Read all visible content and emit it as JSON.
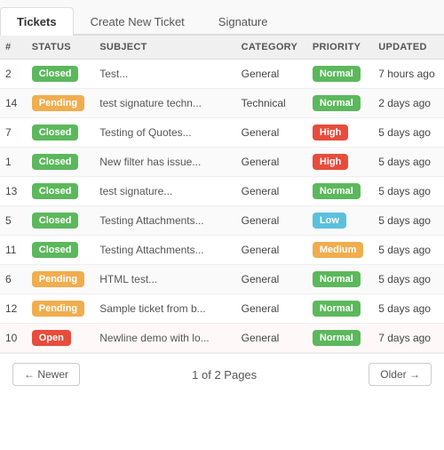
{
  "tabs": [
    {
      "id": "tickets",
      "label": "Tickets",
      "active": true
    },
    {
      "id": "create",
      "label": "Create New Ticket",
      "active": false
    },
    {
      "id": "signature",
      "label": "Signature",
      "active": false
    }
  ],
  "table": {
    "columns": [
      {
        "id": "num",
        "label": "#"
      },
      {
        "id": "status",
        "label": "STATUS"
      },
      {
        "id": "subject",
        "label": "SUBJECT"
      },
      {
        "id": "category",
        "label": "CATEGORY"
      },
      {
        "id": "priority",
        "label": "PRIORITY"
      },
      {
        "id": "updated",
        "label": "UPDATED"
      }
    ],
    "rows": [
      {
        "num": "2",
        "status": "Closed",
        "status_type": "closed",
        "subject": "Test...",
        "category": "General",
        "priority": "Normal",
        "priority_type": "normal",
        "updated": "7 hours ago"
      },
      {
        "num": "14",
        "status": "Pending",
        "status_type": "pending",
        "subject": "test signature techn...",
        "category": "Technical",
        "priority": "Normal",
        "priority_type": "normal",
        "updated": "2 days ago"
      },
      {
        "num": "7",
        "status": "Closed",
        "status_type": "closed",
        "subject": "Testing of Quotes...",
        "category": "General",
        "priority": "High",
        "priority_type": "high",
        "updated": "5 days ago"
      },
      {
        "num": "1",
        "status": "Closed",
        "status_type": "closed",
        "subject": "New filter has issue...",
        "category": "General",
        "priority": "High",
        "priority_type": "high",
        "updated": "5 days ago"
      },
      {
        "num": "13",
        "status": "Closed",
        "status_type": "closed",
        "subject": "test signature...",
        "category": "General",
        "priority": "Normal",
        "priority_type": "normal",
        "updated": "5 days ago"
      },
      {
        "num": "5",
        "status": "Closed",
        "status_type": "closed",
        "subject": "Testing Attachments...",
        "category": "General",
        "priority": "Low",
        "priority_type": "low",
        "updated": "5 days ago"
      },
      {
        "num": "11",
        "status": "Closed",
        "status_type": "closed",
        "subject": "Testing Attachments...",
        "category": "General",
        "priority": "Medium",
        "priority_type": "medium",
        "updated": "5 days ago"
      },
      {
        "num": "6",
        "status": "Pending",
        "status_type": "pending",
        "subject": "HTML test...",
        "category": "General",
        "priority": "Normal",
        "priority_type": "normal",
        "updated": "5 days ago"
      },
      {
        "num": "12",
        "status": "Pending",
        "status_type": "pending",
        "subject": "Sample ticket from b...",
        "category": "General",
        "priority": "Normal",
        "priority_type": "normal",
        "updated": "5 days ago"
      },
      {
        "num": "10",
        "status": "Open",
        "status_type": "open",
        "subject": "Newline demo with lo...",
        "category": "General",
        "priority": "Normal",
        "priority_type": "normal",
        "updated": "7 days ago"
      }
    ]
  },
  "pagination": {
    "newer_label": "← Newer",
    "older_label": "Older →",
    "info": "1 of 2 Pages"
  }
}
